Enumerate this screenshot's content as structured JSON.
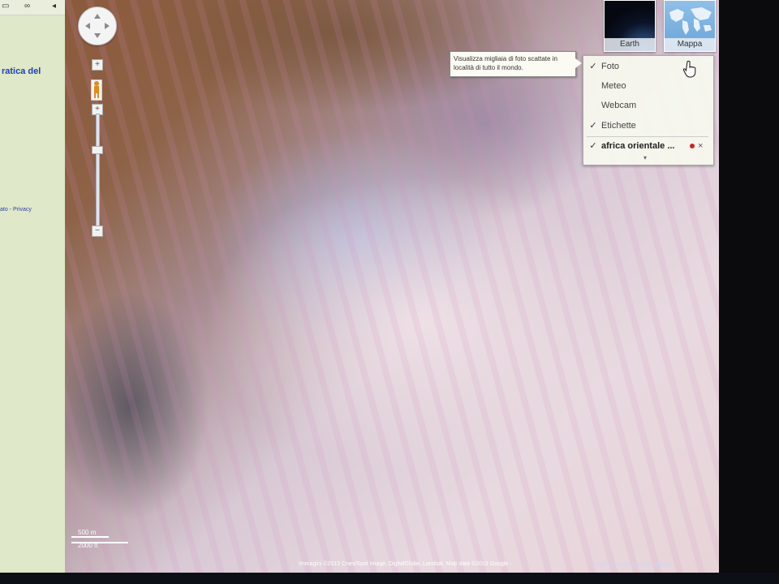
{
  "sidebar": {
    "title_fragment": "ratica del",
    "footer_fragment": "ato - Privacy",
    "toolbar_icons": [
      "print-icon",
      "link-icon",
      "collapse-icon"
    ]
  },
  "map_controls": {
    "zoom_plus": "+",
    "zoom_minus": "−",
    "pan_arrows": "◀ ▶"
  },
  "scale": {
    "metric": "500 m",
    "imperial": "2000 ft"
  },
  "map_types": {
    "earth": "Earth",
    "map": "Mappa"
  },
  "tooltip": {
    "text": "Visualizza migliaia di foto scattate in località di tutto il mondo."
  },
  "layers_menu": {
    "items": [
      {
        "label": "Foto",
        "checked": true
      },
      {
        "label": "Meteo",
        "checked": false
      },
      {
        "label": "Webcam",
        "checked": false
      },
      {
        "label": "Etichette",
        "checked": true
      }
    ],
    "custom_layer": {
      "label": "africa orientale ...",
      "checked": true,
      "close": "×"
    },
    "more": "▾"
  },
  "attribution": "Immagini ©2013 Cnes/Spot Image, DigitalGlobe, Landsat, Map data ©2013 Google -",
  "map_maker_link": "Modifica in Google Map Maker"
}
